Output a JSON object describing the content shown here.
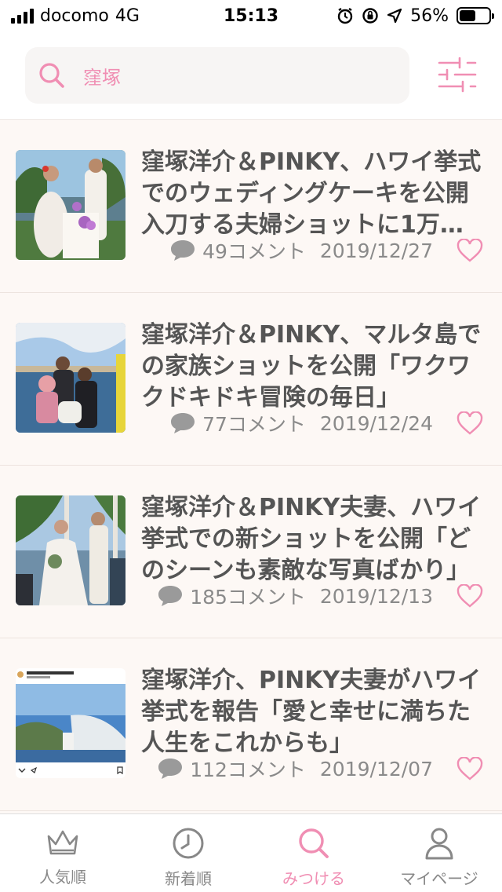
{
  "status_bar": {
    "carrier": "docomo",
    "network": "4G",
    "time": "15:13",
    "battery_percent": "56%",
    "battery_level": 0.56
  },
  "search": {
    "query": "窪塚",
    "icon": "search-icon"
  },
  "filter": {
    "icon": "sliders-icon"
  },
  "articles": [
    {
      "title": "窪塚洋介＆PINKY、ハワイ挙式でのウェディングケーキを公開 入刀する夫婦ショットに1万…",
      "comments": "49コメント",
      "date": "2019/12/27"
    },
    {
      "title": "窪塚洋介＆PINKY、マルタ島での家族ショットを公開「ワクワクドキドキ冒険の毎日」",
      "comments": "77コメント",
      "date": "2019/12/24"
    },
    {
      "title": "窪塚洋介＆PINKY夫妻、ハワイ挙式での新ショットを公開「どのシーンも素敵な写真ばかり」",
      "comments": "185コメント",
      "date": "2019/12/13"
    },
    {
      "title": "窪塚洋介、PINKY夫妻がハワイ挙式を報告「愛と幸せに満ちた人生をこれからも」",
      "comments": "112コメント",
      "date": "2019/12/07"
    }
  ],
  "tabs": [
    {
      "label": "人気順",
      "icon": "crown-icon"
    },
    {
      "label": "新着順",
      "icon": "clock-icon"
    },
    {
      "label": "みつける",
      "icon": "search-icon"
    },
    {
      "label": "マイページ",
      "icon": "user-icon"
    }
  ],
  "colors": {
    "accent": "#f08eb3",
    "text": "#555555",
    "meta": "#8a8a8a",
    "background": "#fdf8f5"
  }
}
